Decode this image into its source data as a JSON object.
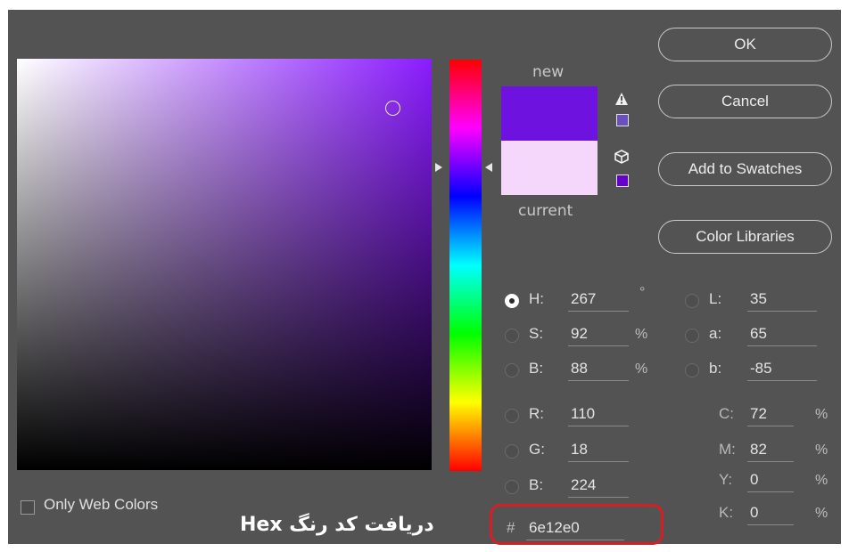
{
  "dialog": {
    "new_label": "new",
    "current_label": "current",
    "colors": {
      "new": "#6e12e0",
      "current": "#f5d7fc",
      "highlight": "#d41f26"
    }
  },
  "buttons": {
    "ok": "OK",
    "cancel": "Cancel",
    "add_to_swatches": "Add to Swatches",
    "color_libraries": "Color Libraries"
  },
  "icons": {
    "gamut_warning": "warning-triangle-icon",
    "web_safe": "cube-icon"
  },
  "fields": {
    "h": {
      "label": "H:",
      "value": "267",
      "unit": "°",
      "selected": true
    },
    "s": {
      "label": "S:",
      "value": "92",
      "unit": "%"
    },
    "b": {
      "label": "B:",
      "value": "88",
      "unit": "%"
    },
    "r": {
      "label": "R:",
      "value": "110"
    },
    "g": {
      "label": "G:",
      "value": "18"
    },
    "b2": {
      "label": "B:",
      "value": "224"
    },
    "l": {
      "label": "L:",
      "value": "35"
    },
    "a": {
      "label": "a:",
      "value": "65"
    },
    "b3": {
      "label": "b:",
      "value": "-85"
    },
    "c": {
      "label": "C:",
      "value": "72",
      "unit": "%"
    },
    "m": {
      "label": "M:",
      "value": "82",
      "unit": "%"
    },
    "y": {
      "label": "Y:",
      "value": "0",
      "unit": "%"
    },
    "k": {
      "label": "K:",
      "value": "0",
      "unit": "%"
    },
    "hex": {
      "label": "#",
      "value": "6e12e0"
    }
  },
  "only_web_colors": "Only Web Colors",
  "caption": "دریافت کد رنگ Hex"
}
